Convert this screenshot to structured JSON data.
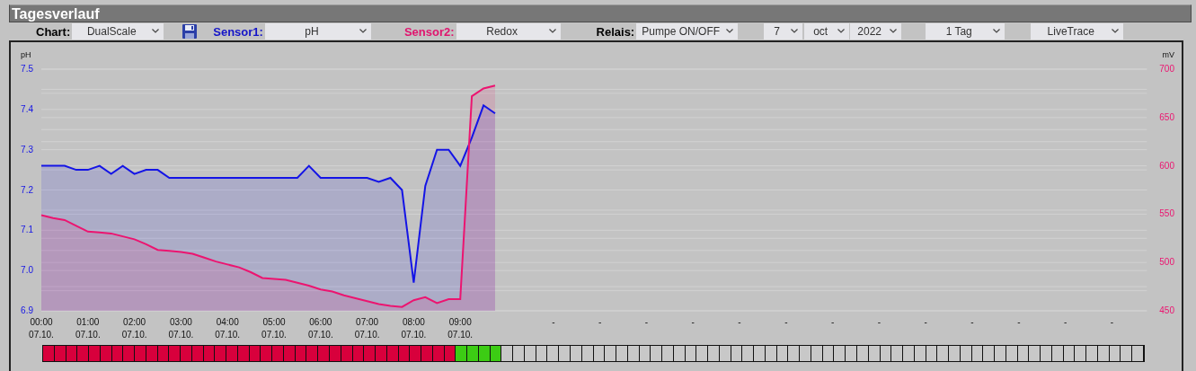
{
  "panel": {
    "title": "Tagesverlauf"
  },
  "toolbar": [
    {
      "kind": "select",
      "label": "Chart:",
      "color": "#000000",
      "value": "DualScale"
    },
    {
      "kind": "save"
    },
    {
      "kind": "select",
      "label": "Sensor1:",
      "color": "#1414c8",
      "value": "pH"
    },
    {
      "kind": "select",
      "label": "Sensor2:",
      "color": "#e0146e",
      "value": "Redox"
    },
    {
      "kind": "select",
      "label": "Relais:",
      "color": "#000000",
      "value": "Pumpe ON/OFF"
    },
    {
      "kind": "select",
      "value": "7"
    },
    {
      "kind": "select",
      "value": "oct"
    },
    {
      "kind": "select",
      "value": "2022"
    },
    {
      "kind": "select",
      "value": "1 Tag"
    },
    {
      "kind": "select",
      "value": "LiveTrace"
    }
  ],
  "chart": {
    "chart_data": {
      "type": "line",
      "ylabel": "pH",
      "y2label": "mV",
      "categories": [
        "00:00\n07.10.",
        null,
        null,
        null,
        "01:00\n07.10.",
        null,
        null,
        null,
        "02:00\n07.10.",
        null,
        null,
        null,
        "03:00\n07.10.",
        null,
        null,
        null,
        "04:00\n07.10.",
        null,
        null,
        null,
        "05:00\n07.10.",
        null,
        null,
        null,
        "06:00\n07.10.",
        null,
        null,
        null,
        "07:00\n07.10.",
        null,
        null,
        null,
        "08:00\n07.10.",
        null,
        null,
        null,
        "09:00\n07.10.",
        null,
        null,
        null,
        null,
        null,
        null,
        null,
        "-",
        null,
        null,
        null,
        "-",
        null,
        null,
        null,
        "-",
        null,
        null,
        null,
        "-",
        null,
        null,
        null,
        "-",
        null,
        null,
        null,
        "-",
        null,
        null,
        null,
        "-",
        null,
        null,
        null,
        "-",
        null,
        null,
        null,
        "-",
        null,
        null,
        null,
        "-",
        null,
        null,
        null,
        "-",
        null,
        null,
        null,
        "-",
        null,
        null,
        null,
        "-",
        null,
        null,
        null
      ],
      "grid": true,
      "ylim": [
        6.9,
        7.5
      ],
      "y2lim": [
        450,
        700
      ],
      "yticks": [
        {
          "value": 6.9,
          "label": "6.9"
        },
        {
          "value": 7.0,
          "label": "7.0"
        },
        {
          "value": 7.1,
          "label": "7.1"
        },
        {
          "value": 7.2,
          "label": "7.2"
        },
        {
          "value": 7.3,
          "label": "7.3"
        },
        {
          "value": 7.4,
          "label": "7.4"
        },
        {
          "value": 7.5,
          "label": "7.5"
        }
      ],
      "y2ticks": [
        {
          "value": 450,
          "label": "450"
        },
        {
          "value": 500,
          "label": "500"
        },
        {
          "value": 550,
          "label": "550"
        },
        {
          "value": 600,
          "label": "600"
        },
        {
          "value": 650,
          "label": "650"
        },
        {
          "value": 700,
          "label": "700"
        }
      ],
      "series": [
        {
          "color": "#1414e6",
          "values": [
            7.26,
            7.26,
            7.26,
            7.25,
            7.25,
            7.26,
            7.24,
            7.26,
            7.24,
            7.25,
            7.25,
            7.23,
            7.23,
            7.23,
            7.23,
            7.23,
            7.23,
            7.23,
            7.23,
            7.23,
            7.23,
            7.23,
            7.23,
            7.26,
            7.23,
            7.23,
            7.23,
            7.23,
            7.23,
            7.22,
            7.23,
            7.2,
            6.97,
            7.21,
            7.3,
            7.3,
            7.26,
            7.33,
            7.41,
            7.39,
            null,
            null,
            null,
            null,
            null,
            null,
            null,
            null,
            null,
            null,
            null,
            null,
            null,
            null,
            null,
            null,
            null,
            null,
            null,
            null,
            null,
            null,
            null,
            null,
            null,
            null,
            null,
            null,
            null,
            null,
            null,
            null,
            null,
            null,
            null,
            null,
            null,
            null,
            null,
            null,
            null,
            null,
            null,
            null,
            null,
            null,
            null,
            null,
            null,
            null,
            null,
            null,
            null,
            null,
            null,
            null
          ]
        },
        {
          "axis": "y2",
          "color": "#ec1470",
          "values": [
            549,
            546,
            544,
            538,
            532,
            531,
            530,
            527,
            524,
            519,
            513,
            512,
            511,
            509,
            505,
            501,
            498,
            495,
            490,
            484,
            483,
            482,
            479,
            476,
            472,
            470,
            466,
            463,
            460,
            457,
            455,
            454,
            461,
            464,
            458,
            462,
            462,
            672,
            680,
            683,
            null,
            null,
            null,
            null,
            null,
            null,
            null,
            null,
            null,
            null,
            null,
            null,
            null,
            null,
            null,
            null,
            null,
            null,
            null,
            null,
            null,
            null,
            null,
            null,
            null,
            null,
            null,
            null,
            null,
            null,
            null,
            null,
            null,
            null,
            null,
            null,
            null,
            null,
            null,
            null,
            null,
            null,
            null,
            null,
            null,
            null,
            null,
            null,
            null,
            null,
            null,
            null,
            null,
            null,
            null,
            null
          ]
        }
      ]
    }
  },
  "relay": {
    "cells": [
      {
        "color": "#d8003c"
      },
      {
        "color": "#d8003c"
      },
      {
        "color": "#d8003c"
      },
      {
        "color": "#d8003c"
      },
      {
        "color": "#d8003c"
      },
      {
        "color": "#d8003c"
      },
      {
        "color": "#d8003c"
      },
      {
        "color": "#d8003c"
      },
      {
        "color": "#d8003c"
      },
      {
        "color": "#d8003c"
      },
      {
        "color": "#d8003c"
      },
      {
        "color": "#d8003c"
      },
      {
        "color": "#d8003c"
      },
      {
        "color": "#d8003c"
      },
      {
        "color": "#d8003c"
      },
      {
        "color": "#d8003c"
      },
      {
        "color": "#d8003c"
      },
      {
        "color": "#d8003c"
      },
      {
        "color": "#d8003c"
      },
      {
        "color": "#d8003c"
      },
      {
        "color": "#d8003c"
      },
      {
        "color": "#d8003c"
      },
      {
        "color": "#d8003c"
      },
      {
        "color": "#d8003c"
      },
      {
        "color": "#d8003c"
      },
      {
        "color": "#d8003c"
      },
      {
        "color": "#d8003c"
      },
      {
        "color": "#d8003c"
      },
      {
        "color": "#d8003c"
      },
      {
        "color": "#d8003c"
      },
      {
        "color": "#d8003c"
      },
      {
        "color": "#d8003c"
      },
      {
        "color": "#d8003c"
      },
      {
        "color": "#d8003c"
      },
      {
        "color": "#d8003c"
      },
      {
        "color": "#d8003c"
      },
      {
        "color": "#3ccc14"
      },
      {
        "color": "#3ccc14"
      },
      {
        "color": "#3ccc14"
      },
      {
        "color": "#3ccc14"
      },
      {
        "color": "#c8c8c8"
      },
      {
        "color": "#c8c8c8"
      },
      {
        "color": "#c8c8c8"
      },
      {
        "color": "#c8c8c8"
      },
      {
        "color": "#c8c8c8"
      },
      {
        "color": "#c8c8c8"
      },
      {
        "color": "#c8c8c8"
      },
      {
        "color": "#c8c8c8"
      },
      {
        "color": "#c8c8c8"
      },
      {
        "color": "#c8c8c8"
      },
      {
        "color": "#c8c8c8"
      },
      {
        "color": "#c8c8c8"
      },
      {
        "color": "#c8c8c8"
      },
      {
        "color": "#c8c8c8"
      },
      {
        "color": "#c8c8c8"
      },
      {
        "color": "#c8c8c8"
      },
      {
        "color": "#c8c8c8"
      },
      {
        "color": "#c8c8c8"
      },
      {
        "color": "#c8c8c8"
      },
      {
        "color": "#c8c8c8"
      },
      {
        "color": "#c8c8c8"
      },
      {
        "color": "#c8c8c8"
      },
      {
        "color": "#c8c8c8"
      },
      {
        "color": "#c8c8c8"
      },
      {
        "color": "#c8c8c8"
      },
      {
        "color": "#c8c8c8"
      },
      {
        "color": "#c8c8c8"
      },
      {
        "color": "#c8c8c8"
      },
      {
        "color": "#c8c8c8"
      },
      {
        "color": "#c8c8c8"
      },
      {
        "color": "#c8c8c8"
      },
      {
        "color": "#c8c8c8"
      },
      {
        "color": "#c8c8c8"
      },
      {
        "color": "#c8c8c8"
      },
      {
        "color": "#c8c8c8"
      },
      {
        "color": "#c8c8c8"
      },
      {
        "color": "#c8c8c8"
      },
      {
        "color": "#c8c8c8"
      },
      {
        "color": "#c8c8c8"
      },
      {
        "color": "#c8c8c8"
      },
      {
        "color": "#c8c8c8"
      },
      {
        "color": "#c8c8c8"
      },
      {
        "color": "#c8c8c8"
      },
      {
        "color": "#c8c8c8"
      },
      {
        "color": "#c8c8c8"
      },
      {
        "color": "#c8c8c8"
      },
      {
        "color": "#c8c8c8"
      },
      {
        "color": "#c8c8c8"
      },
      {
        "color": "#c8c8c8"
      },
      {
        "color": "#c8c8c8"
      },
      {
        "color": "#c8c8c8"
      },
      {
        "color": "#c8c8c8"
      },
      {
        "color": "#c8c8c8"
      },
      {
        "color": "#c8c8c8"
      },
      {
        "color": "#c8c8c8"
      },
      {
        "color": "#c8c8c8"
      }
    ]
  }
}
